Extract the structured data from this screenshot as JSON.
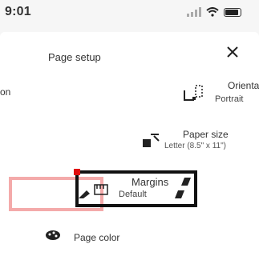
{
  "status": {
    "time": "9:01"
  },
  "sheet": {
    "title": "Page setup",
    "orientation": {
      "left_fragment": "on",
      "label": "Orienta",
      "value": "Portrait"
    },
    "paper_size": {
      "label": "Paper size",
      "value": "Letter (8.5\" x 11\")"
    },
    "margins": {
      "label": "Margins",
      "value": "Default"
    },
    "page_color": {
      "label": "Page color"
    }
  }
}
